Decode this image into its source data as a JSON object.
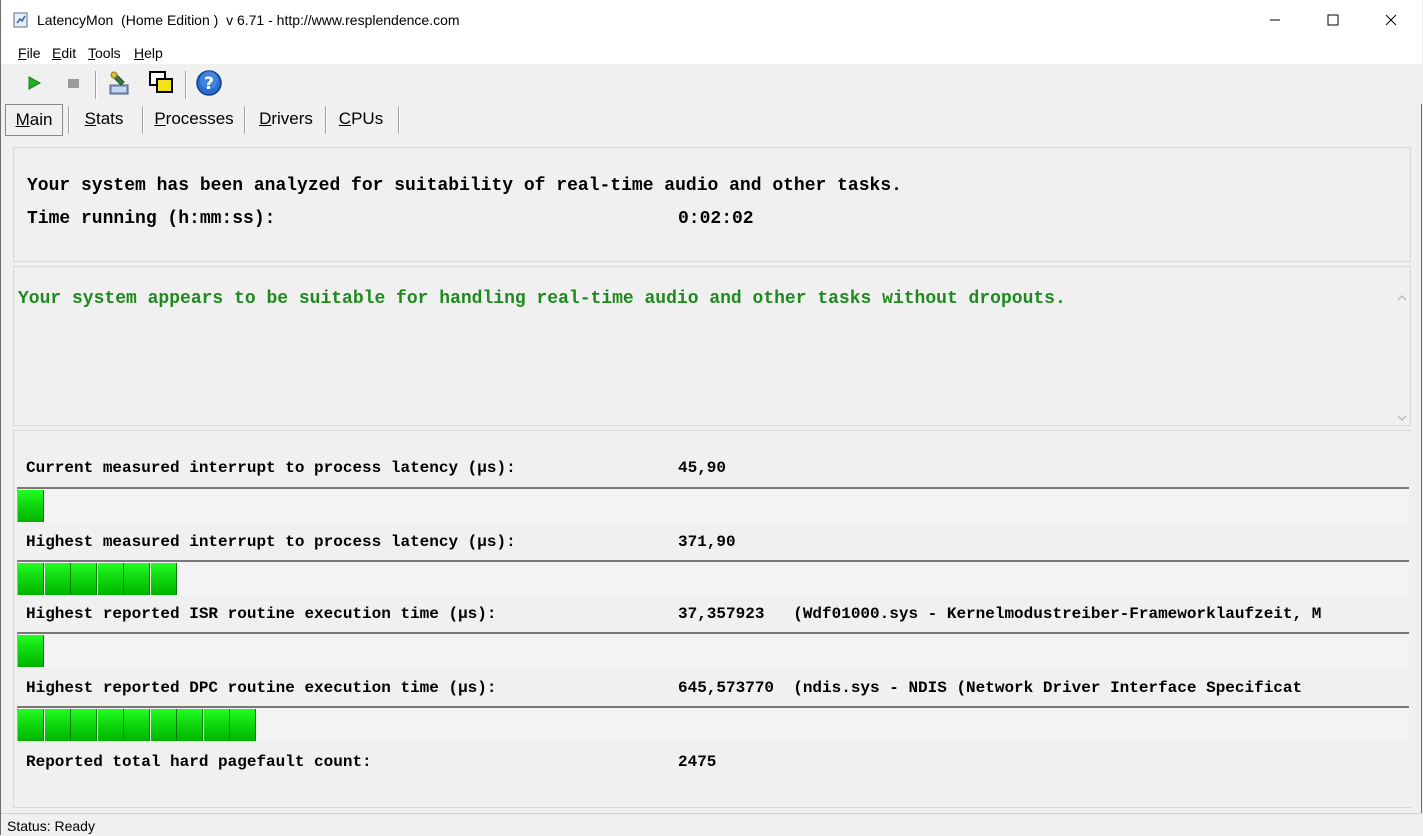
{
  "window": {
    "title": "LatencyMon  (Home Edition )  v 6.71 - http://www.resplendence.com",
    "minimize_glyph": "—",
    "maximize_glyph": "☐",
    "close_glyph": "✕"
  },
  "menu": [
    {
      "accel": "F",
      "rest": "ile"
    },
    {
      "accel": "E",
      "rest": "dit"
    },
    {
      "accel": "T",
      "rest": "ools"
    },
    {
      "accel": "H",
      "rest": "elp"
    }
  ],
  "toolbar": {
    "icons": [
      "play-icon",
      "stop-icon",
      "drivers-tool-icon",
      "windows-icon",
      "help-icon"
    ]
  },
  "tabs": [
    {
      "accel": "M",
      "rest": "ain",
      "active": true
    },
    {
      "accel": "S",
      "rest": "tats",
      "active": false
    },
    {
      "accel": "P",
      "rest": "rocesses",
      "active": false
    },
    {
      "accel": "D",
      "rest": "rivers",
      "active": false
    },
    {
      "accel": "C",
      "rest": "PUs",
      "active": false
    }
  ],
  "summary": {
    "analyzed_text": "Your system has been analyzed for suitability of real-time audio and other tasks.",
    "time_label": "Time running (h:mm:ss):",
    "time_value": "0:02:02"
  },
  "verdict": {
    "message": "Your system appears to be suitable for handling real-time audio and other tasks without dropouts.",
    "color": "#1e8a1e"
  },
  "metrics": [
    {
      "label": "Current measured interrupt to process latency (µs):",
      "value": "45,90",
      "bar_segments": 1
    },
    {
      "label": "Highest measured interrupt to process latency (µs):",
      "value": "371,90",
      "bar_segments": 6
    },
    {
      "label": "Highest reported ISR routine execution time (µs):",
      "value": "37,357923   (Wdf01000.sys - Kernelmodustreiber-Frameworklaufzeit, M",
      "bar_segments": 1
    },
    {
      "label": "Highest reported DPC routine execution time (µs):",
      "value": "645,573770  (ndis.sys - NDIS (Network Driver Interface Specificat",
      "bar_segments": 9
    },
    {
      "label": "Reported total hard pagefault count:",
      "value": "2475",
      "bar_segments": null
    }
  ],
  "status": {
    "text": "Status: Ready"
  }
}
